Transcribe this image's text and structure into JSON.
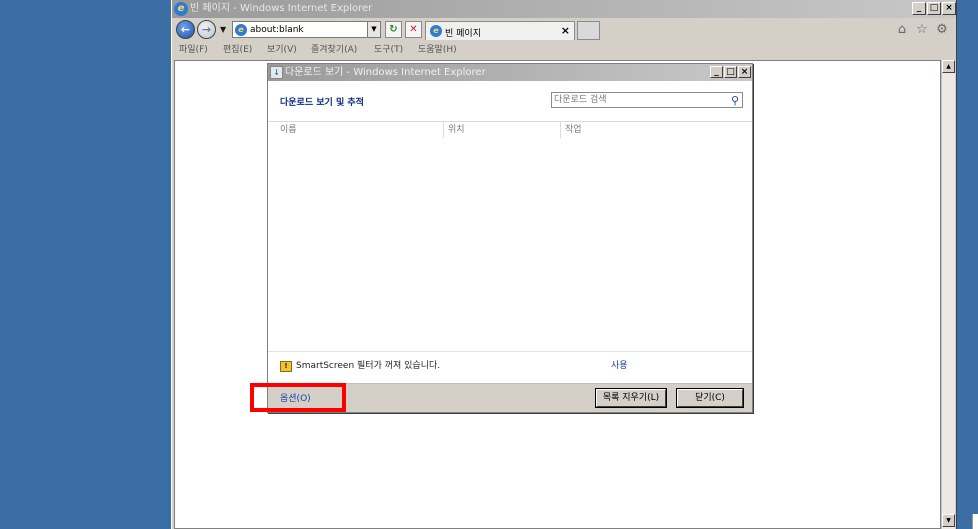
{
  "browser": {
    "title": "빈 페이지 - Windows Internet Explorer",
    "address": "about:blank",
    "tab_label": "빈 페이지",
    "menu": [
      "파일(F)",
      "편집(E)",
      "보기(V)",
      "즐겨찾기(A)",
      "도구(T)",
      "도움말(H)"
    ],
    "icons": {
      "back": "back-arrow-icon",
      "forward": "forward-arrow-icon",
      "refresh": "refresh-icon",
      "stop": "stop-icon",
      "home": "home-icon",
      "favorites": "star-icon",
      "tools": "gear-icon"
    }
  },
  "download_dialog": {
    "title": "다운로드 보기 - Windows Internet Explorer",
    "heading": "다운로드 보기 및 추적",
    "search_placeholder": "다운로드 검색",
    "columns": [
      "이름",
      "위치",
      "작업"
    ],
    "smartscreen_text": "SmartScreen 필터가 꺼져 있습니다.",
    "enable_link": "사용",
    "options_link": "옵션(O)",
    "clear_list_button": "목록 지우기(L)",
    "close_button": "닫기(C)"
  },
  "colors": {
    "desktop": "#3b6ea5",
    "highlight": "#ff0000",
    "heading": "#0c2c84",
    "link": "#1a3ea8"
  }
}
